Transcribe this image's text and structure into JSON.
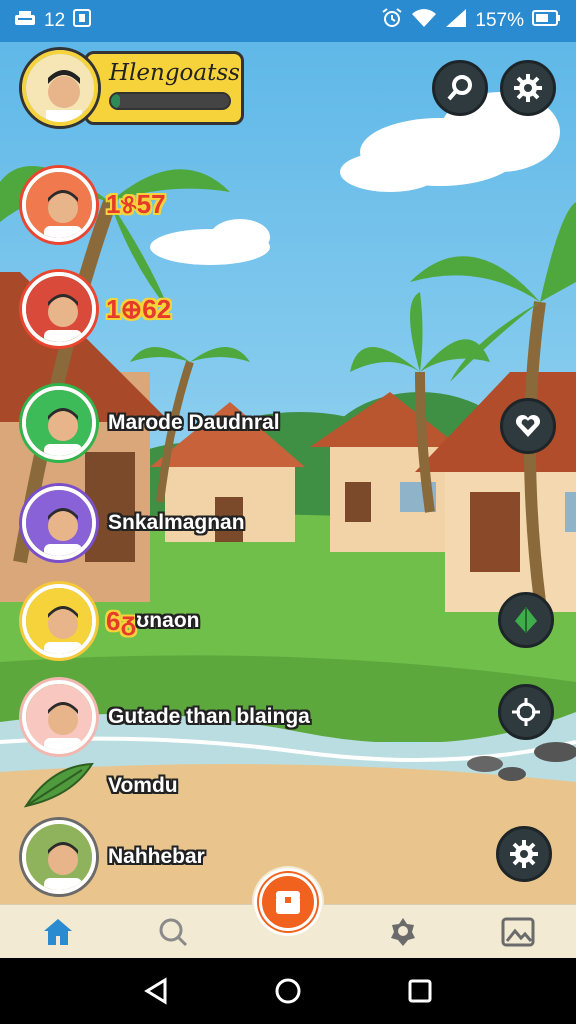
{
  "status_bar": {
    "time": "12",
    "battery": "157%",
    "icons": [
      "notification-icon",
      "notification-icon",
      "alarm-icon",
      "wifi-icon",
      "signal-icon",
      "battery-icon"
    ]
  },
  "top_player": {
    "name": "Hlengoatss",
    "xp_progress": 0.08,
    "avatar_icon": "boy-avatar"
  },
  "players": [
    {
      "name": "",
      "score": "1୫57",
      "avatar_icon": "grandma-avatar",
      "ring": "#e9452f",
      "bg": "#f07a4d"
    },
    {
      "name": "",
      "score": "1⊕62",
      "avatar_icon": "woman-avatar",
      "ring": "#e9452f",
      "bg": "#d94a3a"
    },
    {
      "name": "Marode Daudnral",
      "score": "",
      "avatar_icon": "man-avatar",
      "ring": "#2fb34a",
      "bg": "#3dbb58"
    },
    {
      "name": "Snkalmagnan",
      "score": "",
      "avatar_icon": "woman-avatar-2",
      "ring": "#7a4fc9",
      "bg": "#8a62d8"
    },
    {
      "name": "ʊnaon",
      "score": "6ᵹ",
      "avatar_icon": "boy-avatar-2",
      "ring": "#f6c83b",
      "bg": "#f6d33b"
    },
    {
      "name": "Gutade than blainga",
      "score": "",
      "avatar_icon": "hooded-avatar",
      "ring": "#f3b7b0",
      "bg": "#f7c7c0"
    },
    {
      "name": "Vomdu",
      "score": "",
      "avatar_icon": "leaf-icon",
      "ring": "",
      "bg": ""
    },
    {
      "name": "Nahhebar",
      "score": "",
      "avatar_icon": "man-avatar-2",
      "ring": "#6a6a6a",
      "bg": "#8fb35c"
    }
  ],
  "right_buttons": [
    "search-icon",
    "gear-icon",
    "heart-icon",
    "leaf-icon",
    "crosshair-icon",
    "gear-icon"
  ],
  "bottom_nav": [
    "home-icon",
    "search-icon",
    "chest-icon",
    "badge-icon",
    "picture-icon"
  ],
  "colors": {
    "accent_orange": "#f0621d",
    "nav_bg": "#f2ead2",
    "status_bar": "#2a8bd0",
    "home_active": "#2a8bd0"
  }
}
